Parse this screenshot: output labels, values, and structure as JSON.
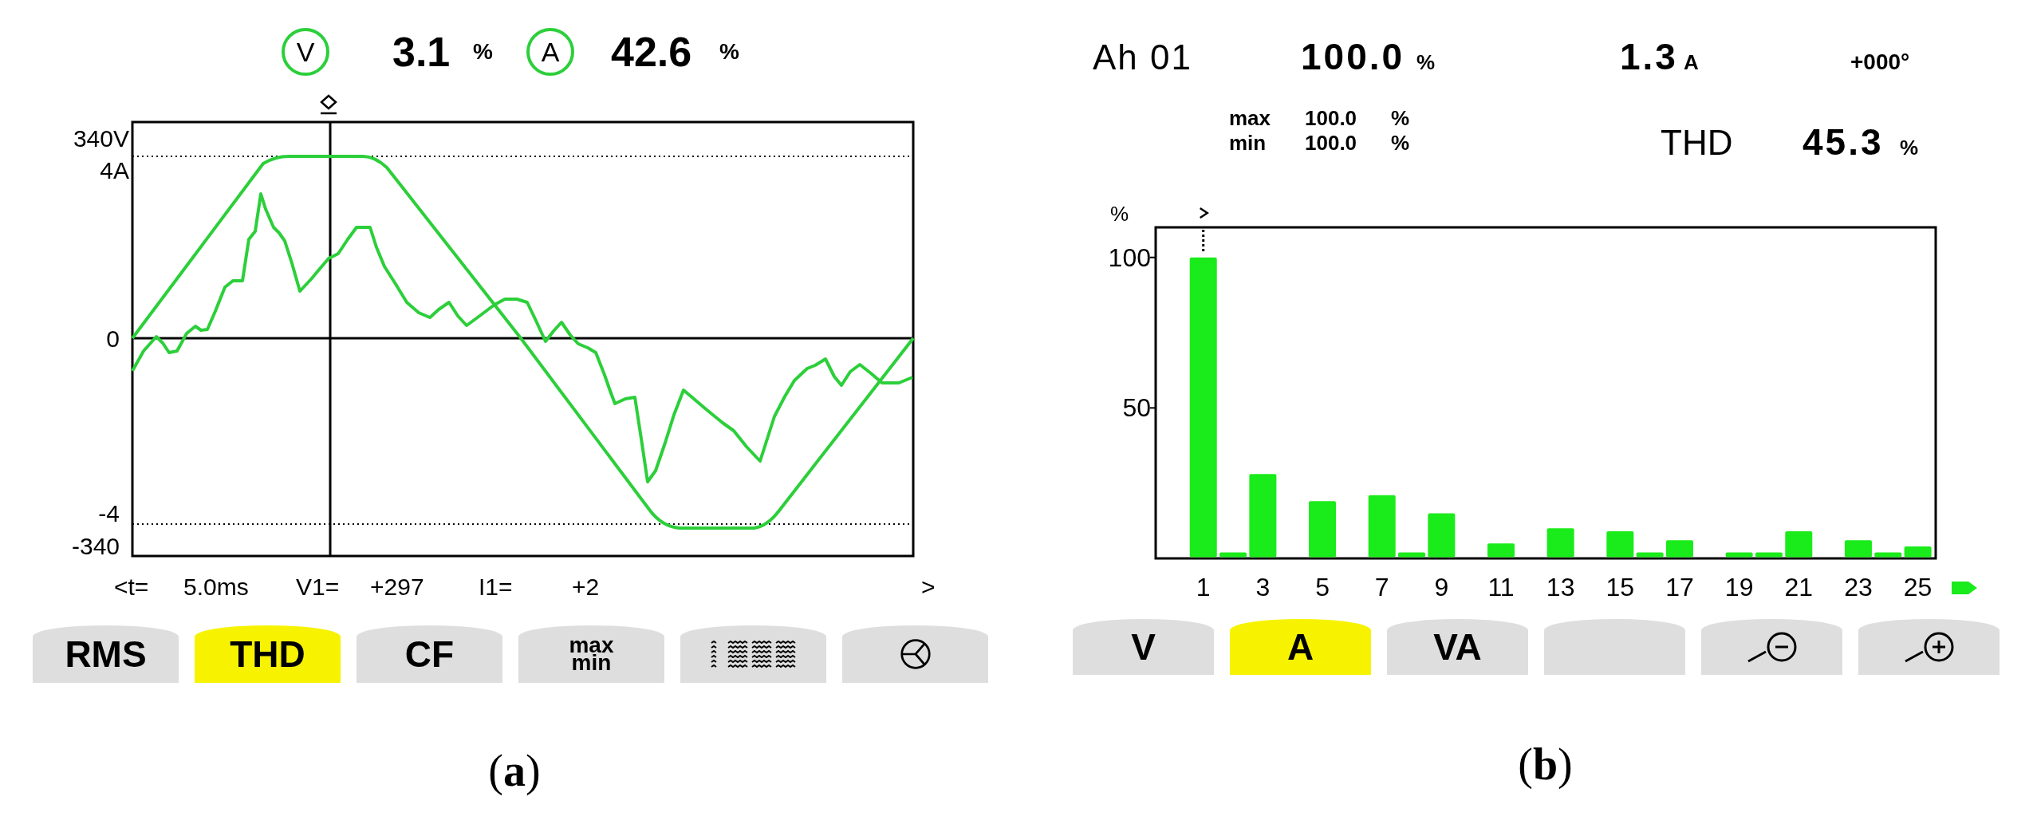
{
  "panel_a": {
    "channels": [
      {
        "symbol": "V",
        "value": "3.1",
        "unit": "%"
      },
      {
        "symbol": "A",
        "value": "42.6",
        "unit": "%"
      }
    ],
    "waveform_chart": {
      "axis_labels": {
        "top_voltage": "340V",
        "top_current": "4A",
        "zero": "0",
        "bottom_current": "-4",
        "bottom_voltage": "-340"
      }
    },
    "cursor_readout": {
      "time_label": "<t=",
      "time_value": "5.0ms",
      "voltage_label": "V1=",
      "voltage_value": "+297",
      "current_label": "I1=",
      "current_value": "+2",
      "next_arrow": ">"
    },
    "softkeys": [
      {
        "kind": "text",
        "label": "RMS",
        "selected": false
      },
      {
        "kind": "text",
        "label": "THD",
        "selected": true
      },
      {
        "kind": "text",
        "label": "CF",
        "selected": false
      },
      {
        "kind": "stacked",
        "lines": [
          "max",
          "min"
        ],
        "selected": false
      },
      {
        "kind": "waves",
        "selected": false
      },
      {
        "kind": "phasor",
        "selected": false
      }
    ],
    "caption": "(**a**)"
  },
  "panel_b": {
    "readout": {
      "harmonic": "Ah 01",
      "percent_value": "100.0",
      "percent_unit": "%",
      "current_value": "1.3",
      "current_unit": "A",
      "phase": "+000°"
    },
    "extremes": [
      {
        "label": "max",
        "value": "100.0",
        "unit": "%"
      },
      {
        "label": "min",
        "value": "100.0",
        "unit": "%"
      }
    ],
    "thd": {
      "label": "THD",
      "value": "45.3",
      "unit": "%"
    },
    "spectrum": {
      "chart_data": {
        "type": "bar",
        "ylabel": "%",
        "x": [
          1,
          2,
          3,
          4,
          5,
          6,
          7,
          8,
          9,
          10,
          11,
          12,
          13,
          14,
          15,
          16,
          17,
          18,
          19,
          20,
          21,
          22,
          23,
          24,
          25
        ],
        "values": [
          100,
          2,
          28,
          0,
          19,
          0,
          21,
          2,
          15,
          0,
          5,
          0,
          10,
          0,
          9,
          2,
          6,
          0,
          2,
          2,
          9,
          0,
          6,
          2,
          4
        ],
        "xlim": [
          -0.6,
          25.6
        ],
        "ylim": [
          0,
          110
        ],
        "xticks": [
          1,
          3,
          5,
          7,
          9,
          11,
          13,
          15,
          17,
          19,
          21,
          23,
          25
        ],
        "yticks": [
          50,
          100
        ]
      }
    },
    "softkeys": [
      {
        "kind": "text",
        "label": "V",
        "selected": false
      },
      {
        "kind": "text",
        "label": "A",
        "selected": true
      },
      {
        "kind": "text",
        "label": "VA",
        "selected": false
      },
      {
        "kind": "blank",
        "selected": false
      },
      {
        "kind": "zoom-out",
        "selected": false
      },
      {
        "kind": "zoom-in",
        "selected": false
      }
    ],
    "caption": "(**b**)"
  }
}
